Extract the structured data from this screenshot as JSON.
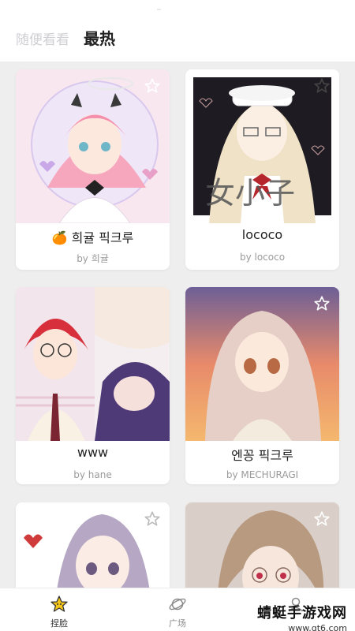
{
  "header": {
    "tab_random": "随便看看",
    "tab_hot": "最热"
  },
  "cards": [
    {
      "title": "🍊 희귤 픽크루",
      "author": "by 희귤"
    },
    {
      "title": "lococo",
      "author": "by lococo"
    },
    {
      "title": "www",
      "author": "by hane"
    },
    {
      "title": "엔꽁 픽크루",
      "author": "by MECHURAGI"
    },
    {
      "title": "",
      "author": ""
    },
    {
      "title": "",
      "author": ""
    }
  ],
  "nav": {
    "face_label": "捏脸",
    "plaza_label": "广场",
    "me_label": ""
  },
  "watermark": {
    "main": "蜻蜓手游戏网",
    "sub": "www.qt6.com"
  },
  "colors": {
    "accent_star": "#f5c518",
    "tab_inactive": "#cfcfd4",
    "tab_active": "#222222"
  },
  "icons": [
    "star-outline-icon",
    "star-filled-icon",
    "planet-icon",
    "profile-icon"
  ]
}
